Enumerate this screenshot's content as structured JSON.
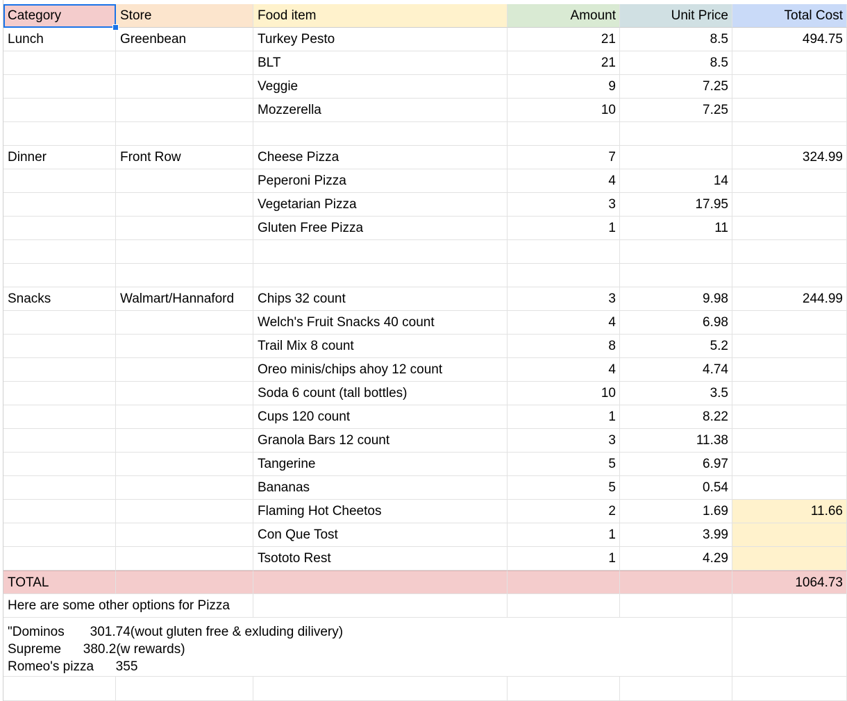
{
  "spreadsheet": {
    "headers": [
      "Category",
      "Store",
      "Food item",
      "Amount",
      "Unit Price",
      "Total Cost"
    ],
    "rows": [
      [
        "Lunch",
        "Greenbean",
        "Turkey Pesto",
        "21",
        "8.5",
        "494.75"
      ],
      [
        "",
        "",
        "BLT",
        "21",
        "8.5",
        ""
      ],
      [
        "",
        "",
        "Veggie",
        "9",
        "7.25",
        ""
      ],
      [
        "",
        "",
        "Mozzerella",
        "10",
        "7.25",
        ""
      ],
      [
        "",
        "",
        "",
        "",
        "",
        ""
      ],
      [
        "Dinner",
        "Front Row",
        "Cheese Pizza",
        "7",
        "",
        "324.99"
      ],
      [
        "",
        "",
        "Peperoni Pizza",
        "4",
        "14",
        ""
      ],
      [
        "",
        "",
        "Vegetarian Pizza",
        "3",
        "17.95",
        ""
      ],
      [
        "",
        "",
        "Gluten Free Pizza",
        "1",
        "11",
        ""
      ],
      [
        "",
        "",
        "",
        "",
        "",
        ""
      ],
      [
        "",
        "",
        "",
        "",
        "",
        ""
      ],
      [
        "Snacks",
        "Walmart/Hannaford",
        "Chips 32 count",
        "3",
        "9.98",
        "244.99"
      ],
      [
        "",
        "",
        "Welch's Fruit Snacks 40 count",
        "4",
        "6.98",
        ""
      ],
      [
        "",
        "",
        "Trail Mix 8 count",
        "8",
        "5.2",
        ""
      ],
      [
        "",
        "",
        "Oreo minis/chips ahoy 12 count",
        "4",
        "4.74",
        ""
      ],
      [
        "",
        "",
        "Soda 6 count (tall bottles)",
        "10",
        "3.5",
        ""
      ],
      [
        "",
        "",
        "Cups 120 count",
        "1",
        "8.22",
        ""
      ],
      [
        "",
        "",
        "Granola Bars 12 count",
        "3",
        "11.38",
        ""
      ],
      [
        "",
        "",
        "Tangerine",
        "5",
        "6.97",
        ""
      ],
      [
        "",
        "",
        "Bananas",
        "5",
        "0.54",
        ""
      ],
      [
        "",
        "",
        "Flaming Hot Cheetos",
        "2",
        "1.69",
        "11.66"
      ],
      [
        "",
        "",
        "Con Que Tost",
        "1",
        "3.99",
        ""
      ],
      [
        "",
        "",
        "Tsototo Rest",
        "1",
        "4.29",
        ""
      ]
    ],
    "total_row": [
      "TOTAL",
      "",
      "",
      "",
      "",
      "1064.73"
    ],
    "note": "Here are some other options for Pizza",
    "options": "\"Dominos       301.74(wout gluten free & exluding dilivery)\nSupreme      380.2(w rewards)\nRomeo's pizza      355",
    "colors": {
      "category": "#f4cccc",
      "store": "#fce5cd",
      "food": "#fff2cc",
      "amount": "#d9ead3",
      "unit_price": "#d0e0e3",
      "total_cost": "#c9daf8",
      "total_row": "#f4cccc",
      "highlight": "#fff2cc",
      "selection": "#1a73e8"
    }
  }
}
